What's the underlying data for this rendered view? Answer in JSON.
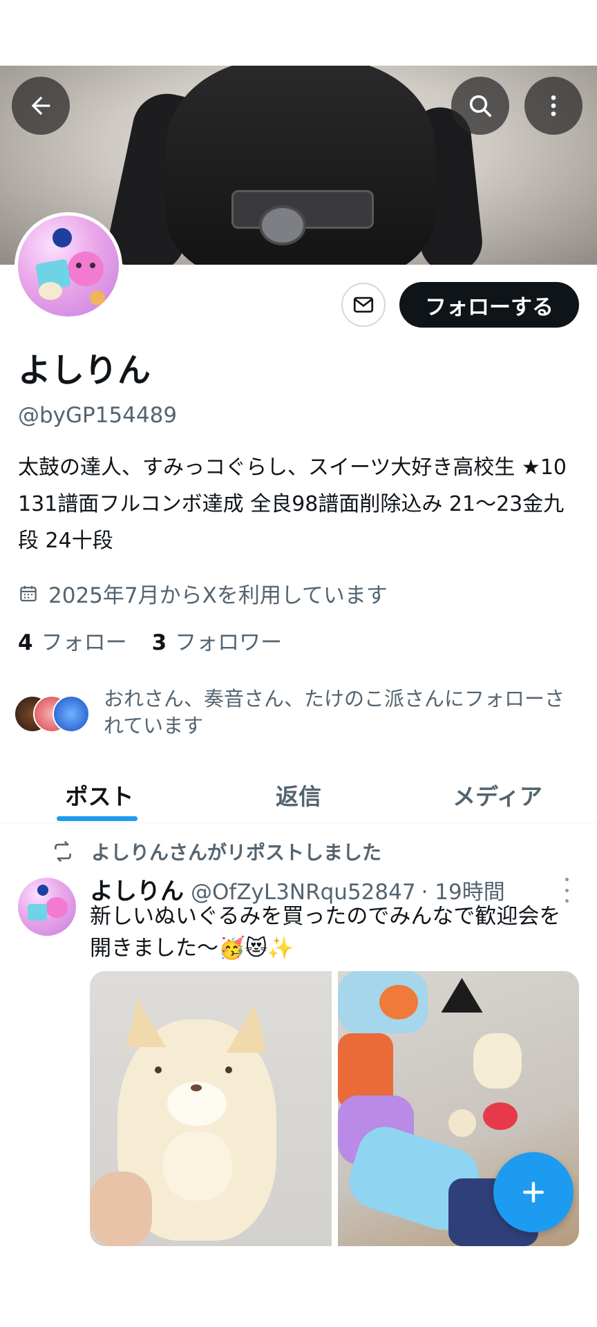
{
  "header": {
    "back_icon": "arrow-left-icon",
    "search_icon": "search-icon",
    "more_icon": "more-vertical-icon"
  },
  "profile": {
    "name": "よしりん",
    "handle": "@byGP154489",
    "bio": "太鼓の達人、すみっコぐらし、スイーツ大好き高校生 ★10 131譜面フルコンボ達成 全良98譜面削除込み 21〜23金九段 24十段",
    "joined": "2025年7月からXを利用しています",
    "following_count": "4",
    "following_label": "フォロー",
    "followers_count": "3",
    "followers_label": "フォロワー",
    "followed_by": "おれさん、奏音さん、たけのこ派さんにフォローされています"
  },
  "actions": {
    "message_icon": "mail-icon",
    "follow_label": "フォローする"
  },
  "tabs": [
    {
      "label": "ポスト",
      "active": true
    },
    {
      "label": "返信",
      "active": false
    },
    {
      "label": "メディア",
      "active": false
    }
  ],
  "post": {
    "repost_label": "よしりんさんがリポストしました",
    "author_name": "よしりん",
    "author_handle": "@OfZyL3NRqu52847",
    "time": "· 19時間",
    "text": "新しいぬいぐるみを買ったのでみんなで歓迎会を開きました〜🥳😻✨"
  },
  "fab": {
    "icon": "plus-icon"
  },
  "colors": {
    "accent": "#1d9bf0",
    "text": "#0f1419",
    "secondary": "#536471"
  }
}
